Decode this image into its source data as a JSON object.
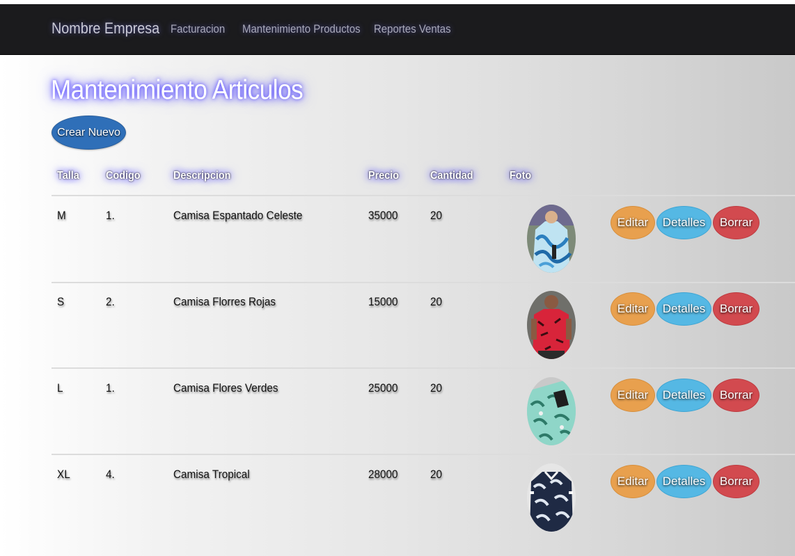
{
  "navbar": {
    "brand": "Nombre Empresa",
    "links": [
      {
        "label": "Facturacion"
      },
      {
        "label": "Mantenimiento Productos"
      },
      {
        "label": "Reportes Ventas"
      }
    ]
  },
  "page": {
    "title": "Mantenimiento Articulos",
    "create_button": "Crear Nuevo"
  },
  "table": {
    "headers": {
      "talla": "Talla",
      "codigo": "Codigo",
      "descripcion": "Descripcion",
      "precio": "Precio",
      "cantidad": "Cantidad",
      "foto": "Foto"
    },
    "actions": {
      "edit": "Editar",
      "details": "Detalles",
      "delete": "Borrar"
    },
    "rows": [
      {
        "talla": "M",
        "codigo": "1.",
        "descripcion": "Camisa Espantado Celeste",
        "precio": "35000",
        "cantidad": "20"
      },
      {
        "talla": "S",
        "codigo": "2.",
        "descripcion": "Camisa Florres Rojas",
        "precio": "15000",
        "cantidad": "20"
      },
      {
        "talla": "L",
        "codigo": "1.",
        "descripcion": "Camisa Flores Verdes",
        "precio": "25000",
        "cantidad": "20"
      },
      {
        "talla": "XL",
        "codigo": "4.",
        "descripcion": "Camisa Tropical",
        "precio": "28000",
        "cantidad": "20"
      }
    ]
  },
  "colors": {
    "navbar_bg": "#1b1b1d",
    "create_button": "#2f6fb8",
    "edit_button": "#e8a04e",
    "details_button": "#55b8e4",
    "delete_button": "#d24a4f",
    "title_glow": "#4a3cff"
  }
}
